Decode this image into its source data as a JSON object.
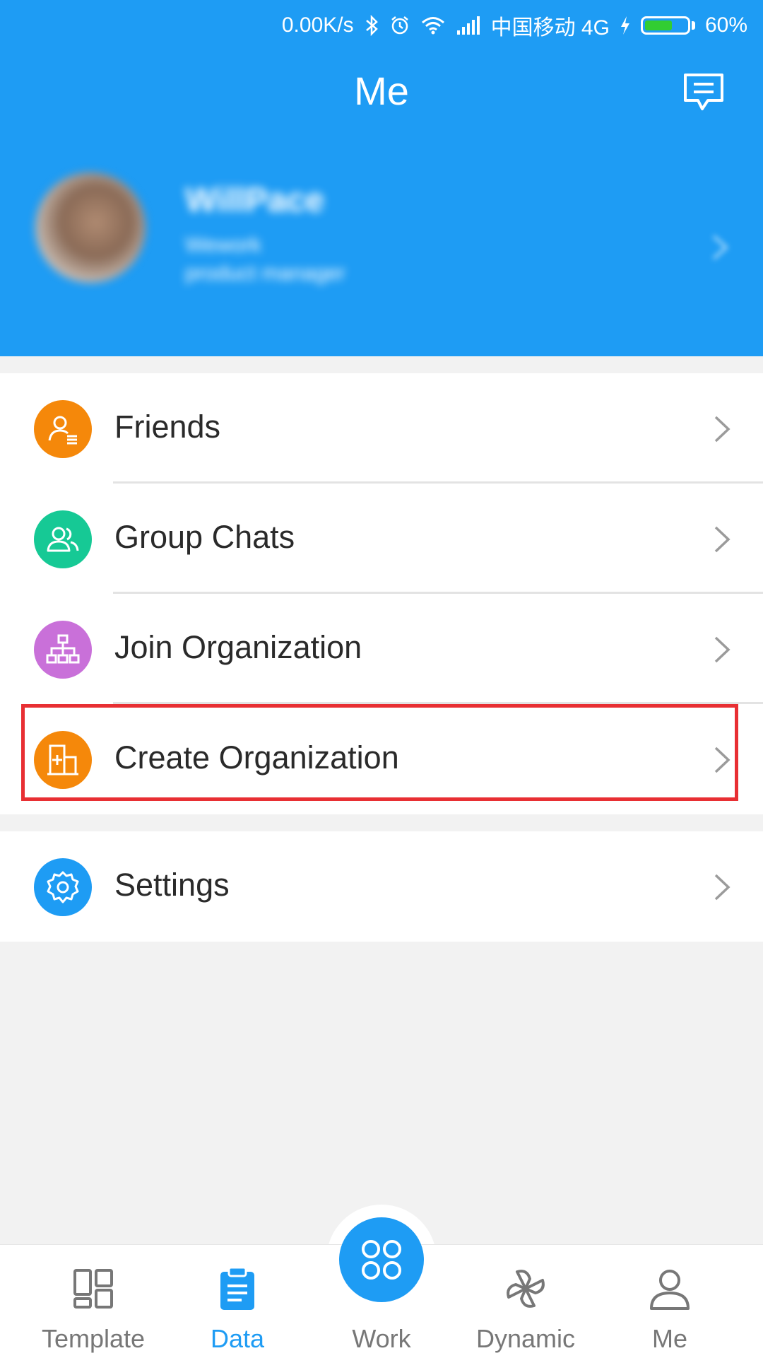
{
  "status_bar": {
    "speed": "0.00K/s",
    "carrier": "中国移动 4G",
    "battery": "60%",
    "battery_level": 0.6
  },
  "header": {
    "title": "Me"
  },
  "profile": {
    "name": "WillPace",
    "company": "Wework",
    "role": "product manager"
  },
  "menu": {
    "friends": "Friends",
    "group_chats": "Group Chats",
    "join_org": "Join Organization",
    "create_org": "Create Organization",
    "settings": "Settings"
  },
  "tabs": {
    "template": "Template",
    "data": "Data",
    "work": "Work",
    "dynamic": "Dynamic",
    "me": "Me"
  },
  "colors": {
    "primary": "#1e9cf4",
    "friends_icon": "#f5880a",
    "group_icon": "#16c995",
    "join_icon": "#c970d9",
    "create_icon": "#f5880a",
    "settings_icon": "#1e9cf4",
    "highlight": "#e82f33"
  }
}
